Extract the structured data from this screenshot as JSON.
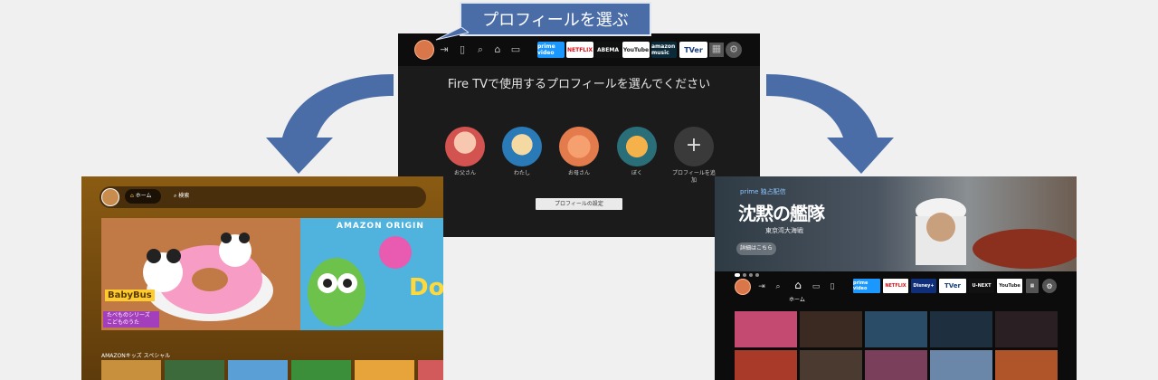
{
  "callout": {
    "text": "プロフィールを選ぶ"
  },
  "center_screen": {
    "prompt": "Fire TVで使用するプロフィールを選んでください",
    "profiles": [
      {
        "label": "お父さん",
        "color": "#d25350"
      },
      {
        "label": "わたし",
        "color": "#2a7ab8"
      },
      {
        "label": "お母さん",
        "color": "#e47b4c"
      },
      {
        "label": "ぼく",
        "color": "#2a6e7a"
      }
    ],
    "add_profile_label": "プロフィールを追加",
    "add_symbol": "+",
    "settings_button": "プロフィールの設定",
    "apps": [
      "prime video",
      "NETFLIX",
      "ABEMA",
      "YouTube",
      "amazon music",
      "TVer"
    ]
  },
  "left_screen": {
    "nav_home": "ホーム",
    "nav_search": "検索",
    "hero_banner_text": "AMAZON ORIGIN",
    "hero_brand": "BabyBus",
    "hero_series": "たべものシリーズ こどものうた",
    "row_title": "AMAZONキッズ スペシャル",
    "hero2_title": "Do Re Mi"
  },
  "right_screen": {
    "prime_label": "prime 独占配信",
    "movie_title": "沈黙の艦隊",
    "movie_subtitle": "東京湾大海戦",
    "details_button": "詳細はこちら",
    "home_label": "ホーム",
    "apps": [
      "prime video",
      "NETFLIX",
      "Disney+",
      "TVer",
      "U-NEXT",
      "YouTube"
    ]
  },
  "colors": {
    "arrow": "#4a6da7",
    "callout_bg": "#4a6da7",
    "page_bg": "#f0f0f0"
  }
}
